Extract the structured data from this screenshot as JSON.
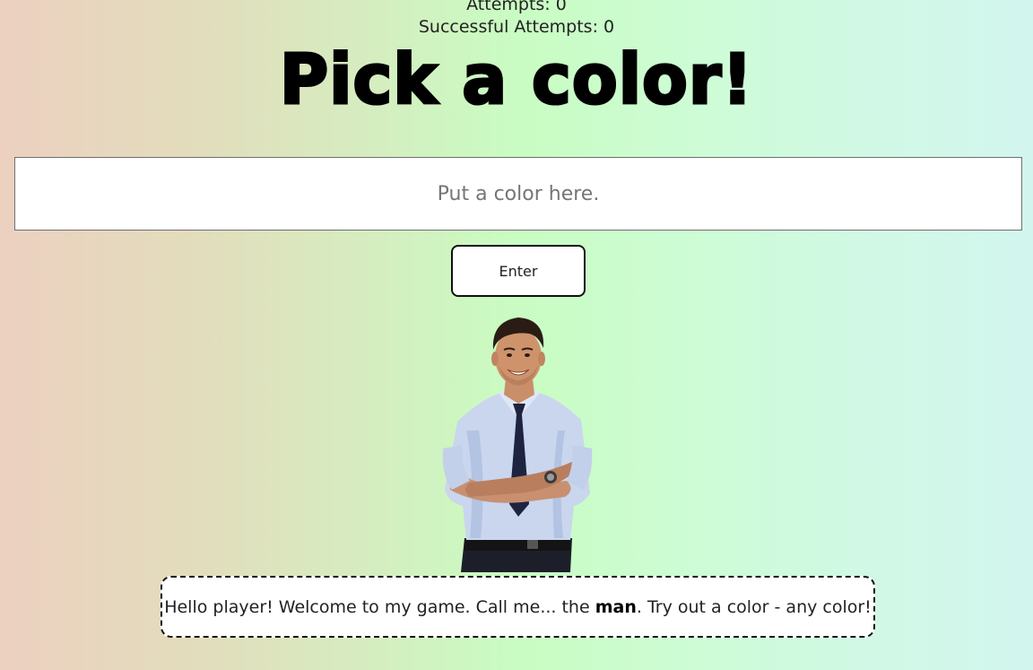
{
  "stats": {
    "attempts": "Attempts: 0",
    "successful_attempts": "Successful Attempts: 0"
  },
  "title": "Pick a color!",
  "color_input": {
    "placeholder": "Put a color here.",
    "value": ""
  },
  "enter_button": {
    "label": "Enter"
  },
  "character": {
    "icon": "man-in-shirt-and-tie-figure"
  },
  "dialogue": {
    "before": "Hello player! Welcome to my game. Call me... the ",
    "emphasis": "man",
    "after": ". Try out a color - any color!"
  },
  "colors": {
    "input_border": "#6f6f6f",
    "button_border": "#111111",
    "bubble_border": "#111111"
  }
}
